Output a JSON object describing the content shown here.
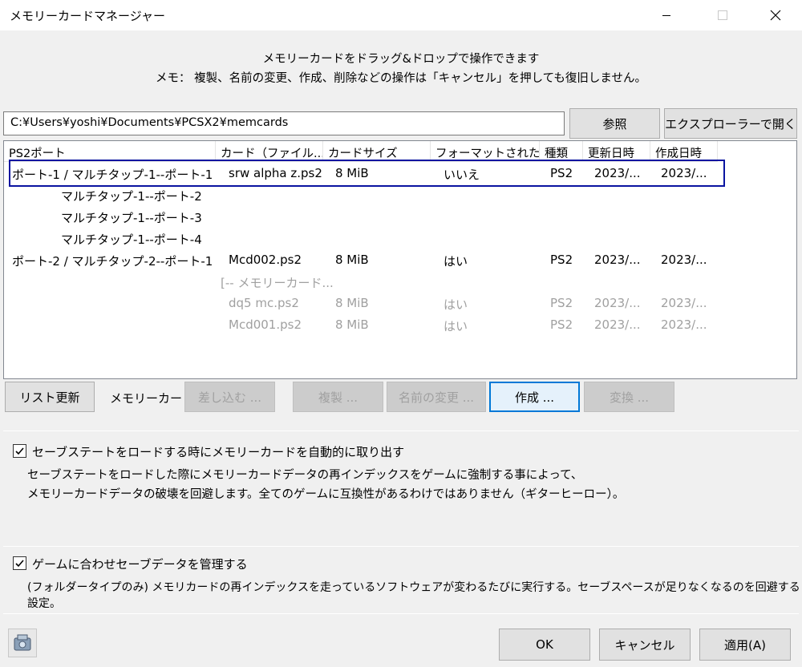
{
  "window": {
    "title": "メモリーカードマネージャー",
    "icons": [
      "minimize-icon",
      "maximize-icon",
      "close-icon"
    ]
  },
  "header": {
    "line1": "メモリーカードをドラッグ&ドロップで操作できます",
    "line2": "メモ： 複製、名前の変更、作成、削除などの操作は「キャンセル」を押しても復旧しません。"
  },
  "path": {
    "value": "C:¥Users¥yoshi¥Documents¥PCSX2¥memcards",
    "browse_label": "参照",
    "open_explorer_label": "エクスプローラーで開く"
  },
  "list": {
    "columns": [
      "PS2ポート",
      "カード（ファイル...",
      "カードサイズ",
      "フォーマットされた",
      "種類",
      "更新日時",
      "作成日時"
    ],
    "rows": [
      {
        "port": "ポート-1 / マルチタップ-1--ポート-1",
        "card": "srw alpha z.ps2",
        "size": "8 MiB",
        "formatted": "いいえ",
        "type": "PS2",
        "modified": "2023/...",
        "created": "2023/..."
      },
      {
        "port": "マルチタップ-1--ポート-2",
        "card": "",
        "size": "",
        "formatted": "",
        "type": "",
        "modified": "",
        "created": ""
      },
      {
        "port": "マルチタップ-1--ポート-3",
        "card": "",
        "size": "",
        "formatted": "",
        "type": "",
        "modified": "",
        "created": ""
      },
      {
        "port": "マルチタップ-1--ポート-4",
        "card": "",
        "size": "",
        "formatted": "",
        "type": "",
        "modified": "",
        "created": ""
      },
      {
        "port": "ポート-2 / マルチタップ-2--ポート-1",
        "card": "Mcd002.ps2",
        "size": "8 MiB",
        "formatted": "はい",
        "type": "PS2",
        "modified": "2023/...",
        "created": "2023/..."
      },
      {
        "port": "",
        "card": "[-- メモリーカード...",
        "size": "",
        "formatted": "",
        "type": "",
        "modified": "",
        "created": ""
      },
      {
        "port": "",
        "card": "dq5 mc.ps2",
        "size": "8 MiB",
        "formatted": "はい",
        "type": "PS2",
        "modified": "2023/...",
        "created": "2023/..."
      },
      {
        "port": "",
        "card": "Mcd001.ps2",
        "size": "8 MiB",
        "formatted": "はい",
        "type": "PS2",
        "modified": "2023/...",
        "created": "2023/..."
      }
    ]
  },
  "actions": {
    "refresh_label": "リスト更新",
    "memcard_label": "メモリーカード:",
    "insert_label": "差し込む ...",
    "duplicate_label": "複製 ...",
    "rename_label": "名前の変更 ...",
    "create_label": "作成 ...",
    "convert_label": "変換 ..."
  },
  "options": {
    "eject_on_load": {
      "checked": true,
      "label": "セーブステートをロードする時にメモリーカードを自動的に取り出す",
      "desc1": "セーブステートをロードした際にメモリーカードデータの再インデックスをゲームに強制する事によって、",
      "desc2": "メモリーカードデータの破壊を回避します。全てのゲームに互換性があるわけではありません（ギターヒーロー）。"
    },
    "manage_saves": {
      "checked": true,
      "label": "ゲームに合わせセーブデータを管理する",
      "desc": "(フォルダータイプのみ) メモリカードの再インデックスを走っているソフトウェアが変わるたびに実行する。セーブスペースが足りなくなるのを回避する設定。"
    }
  },
  "footer": {
    "ok_label": "OK",
    "cancel_label": "キャンセル",
    "apply_label": "適用(A)",
    "icon": "memory-card-icon"
  },
  "colors": {
    "selection_border": "#0a14a0",
    "focus_border": "#0078d7",
    "disabled_text": "#a0a0a0"
  }
}
